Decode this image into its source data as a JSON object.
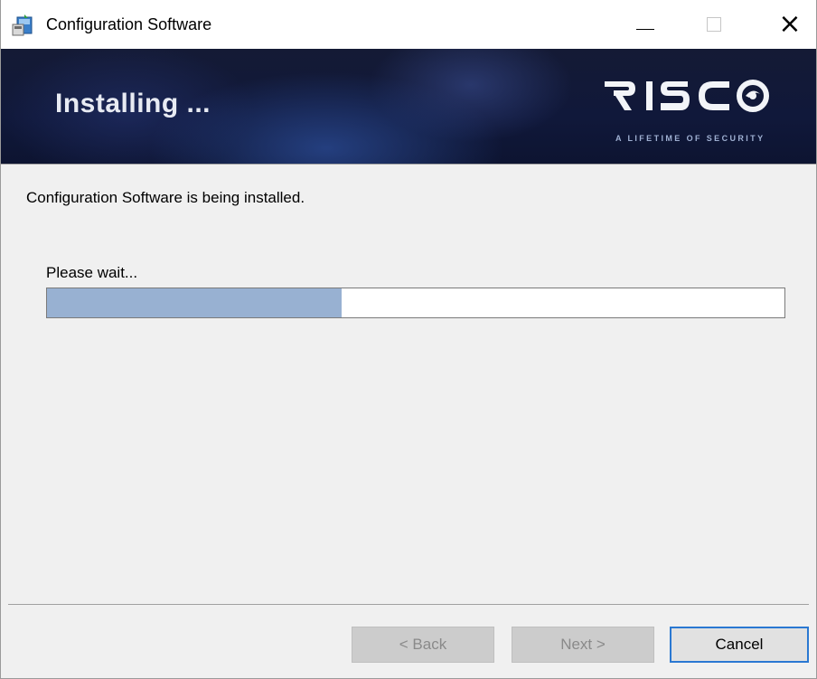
{
  "window": {
    "title": "Configuration Software",
    "controls": {
      "minimize": "minimize-icon",
      "maximize": "maximize-icon",
      "close": "×"
    }
  },
  "banner": {
    "heading": "Installing ...",
    "logo_text": "RISCO",
    "tagline": "A LIFETIME OF SECURITY",
    "colors": {
      "background": "#141a35",
      "heading": "#e8ebf3"
    }
  },
  "content": {
    "status_text": "Configuration Software is being installed.",
    "wait_text": "Please wait...",
    "progress_fraction": 0.4,
    "progress_color": "#98b1d2"
  },
  "buttons": {
    "back_label": "< Back",
    "next_label": "Next >",
    "cancel_label": "Cancel",
    "back_enabled": false,
    "next_enabled": false,
    "cancel_focus_color": "#2a78d2"
  }
}
